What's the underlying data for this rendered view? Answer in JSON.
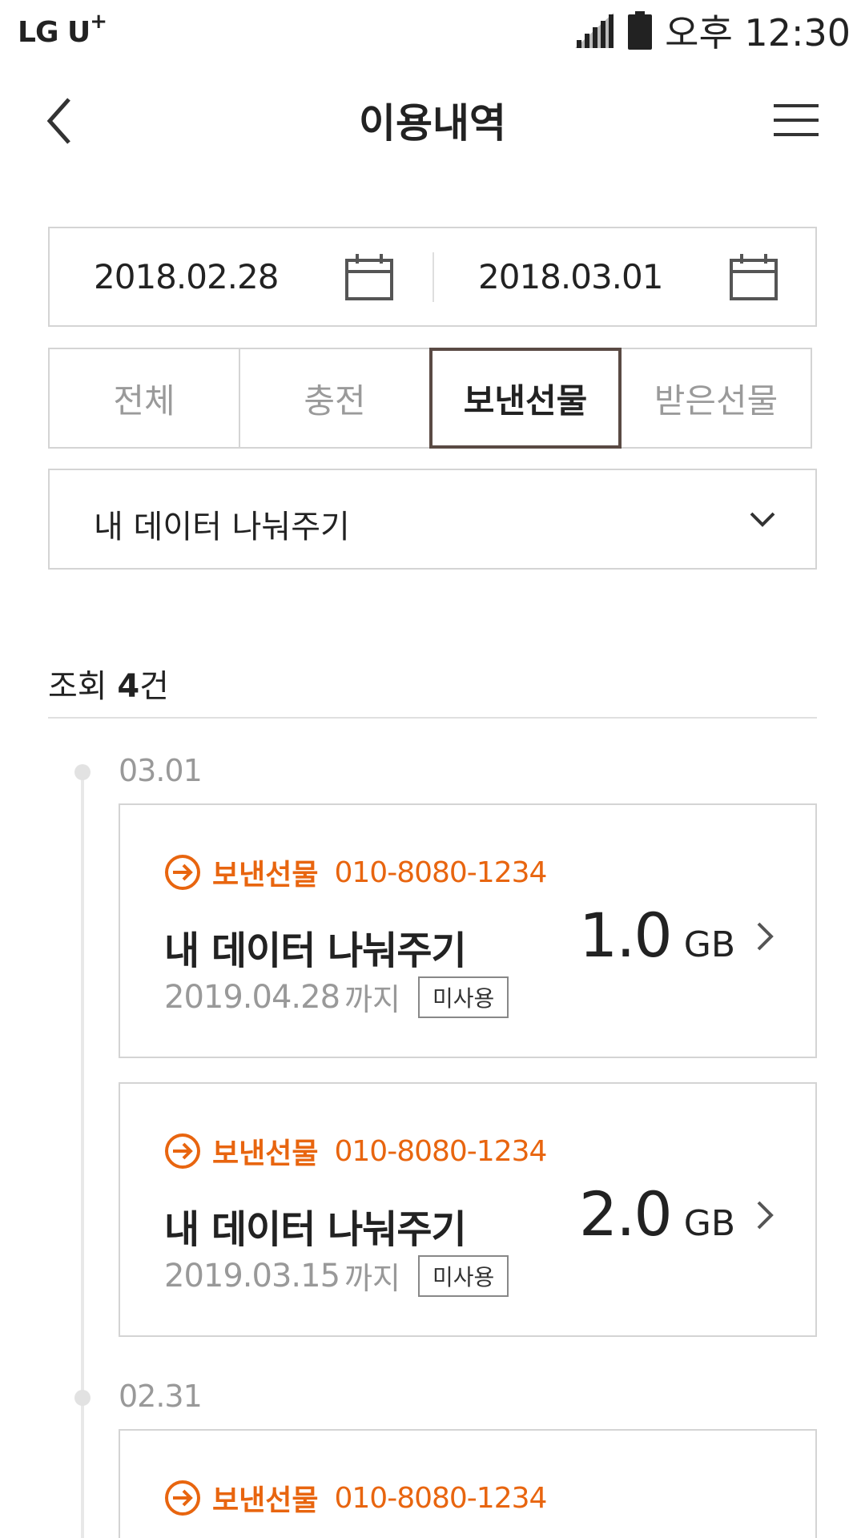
{
  "status_bar": {
    "carrier": "LG U",
    "carrier_plus": "+",
    "time": "오후 12:30"
  },
  "header": {
    "title": "이용내역"
  },
  "date_range": {
    "start": "2018.02.28",
    "end": "2018.03.01"
  },
  "tabs": [
    {
      "label": "전체",
      "active": false
    },
    {
      "label": "충전",
      "active": false
    },
    {
      "label": "보낸선물",
      "active": true
    },
    {
      "label": "받은선물",
      "active": false
    }
  ],
  "filter": {
    "selected": "내 데이터 나눠주기"
  },
  "result": {
    "prefix": "조회",
    "count": "4",
    "suffix": "건"
  },
  "groups": [
    {
      "date": "03.01",
      "items": [
        {
          "type": "보낸선물",
          "phone": "010-8080-1234",
          "title": "내 데이터 나눠주기",
          "expiry": "2019.04.28",
          "expiry_suffix": "까지",
          "status": "미사용",
          "amount": "1.0",
          "unit": "GB"
        },
        {
          "type": "보낸선물",
          "phone": "010-8080-1234",
          "title": "내 데이터 나눠주기",
          "expiry": "2019.03.15",
          "expiry_suffix": "까지",
          "status": "미사용",
          "amount": "2.0",
          "unit": "GB"
        }
      ]
    },
    {
      "date": "02.31",
      "items": [
        {
          "type": "보낸선물",
          "phone": "010-8080-1234",
          "title": "",
          "expiry": "",
          "expiry_suffix": "",
          "status": "",
          "amount": "",
          "unit": ""
        }
      ]
    }
  ],
  "colors": {
    "accent": "#e8650f",
    "active_tab_border": "#5a4a44",
    "border": "#d4d4d4"
  }
}
